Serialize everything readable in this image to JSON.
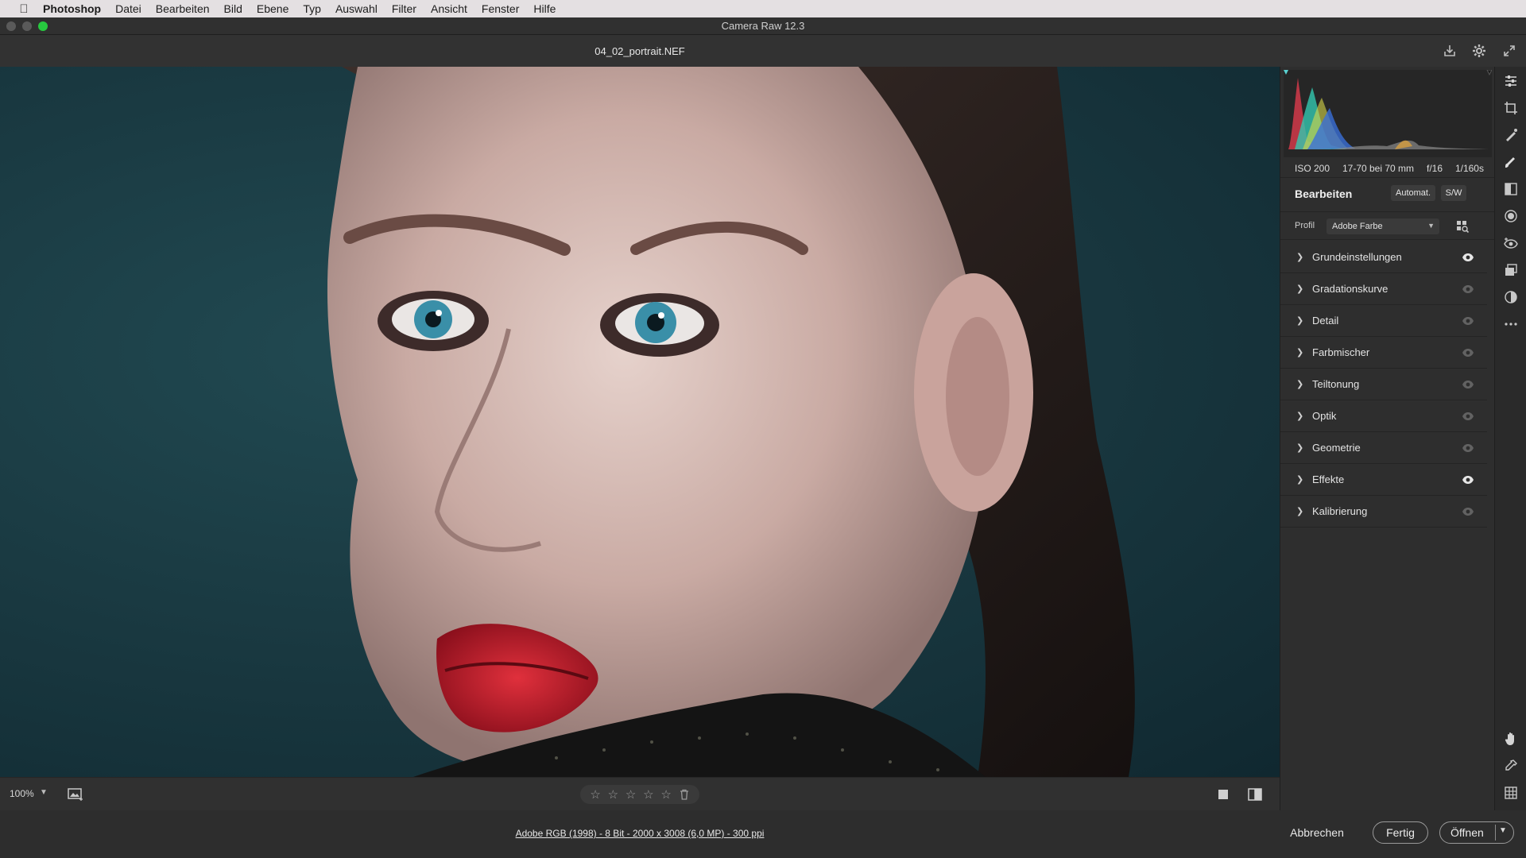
{
  "menubar": {
    "app": "Photoshop",
    "items": [
      "Datei",
      "Bearbeiten",
      "Bild",
      "Ebene",
      "Typ",
      "Auswahl",
      "Filter",
      "Ansicht",
      "Fenster",
      "Hilfe"
    ]
  },
  "window": {
    "title": "Camera Raw 12.3"
  },
  "header": {
    "filename": "04_02_portrait.NEF"
  },
  "image_toolbar": {
    "zoom": "100%"
  },
  "histogram": {
    "exif": {
      "iso": "ISO 200",
      "lens": "17-70 bei 70 mm",
      "aperture": "f/16",
      "shutter": "1/160s"
    }
  },
  "panel": {
    "title": "Bearbeiten",
    "auto_label": "Automat.",
    "bw_label": "S/W",
    "profile_label": "Profil",
    "profile_value": "Adobe Farbe",
    "sections": [
      {
        "label": "Grundeinstellungen",
        "eye_active": true
      },
      {
        "label": "Gradationskurve",
        "eye_active": false
      },
      {
        "label": "Detail",
        "eye_active": false
      },
      {
        "label": "Farbmischer",
        "eye_active": false
      },
      {
        "label": "Teiltonung",
        "eye_active": false
      },
      {
        "label": "Optik",
        "eye_active": false
      },
      {
        "label": "Geometrie",
        "eye_active": false
      },
      {
        "label": "Effekte",
        "eye_active": true
      },
      {
        "label": "Kalibrierung",
        "eye_active": false
      }
    ]
  },
  "footer": {
    "file_info": "Adobe RGB (1998) - 8 Bit - 2000 x 3008 (6,0 MP) - 300 ppi",
    "cancel_label": "Abbrechen",
    "done_label": "Fertig",
    "open_label": "Öffnen"
  }
}
